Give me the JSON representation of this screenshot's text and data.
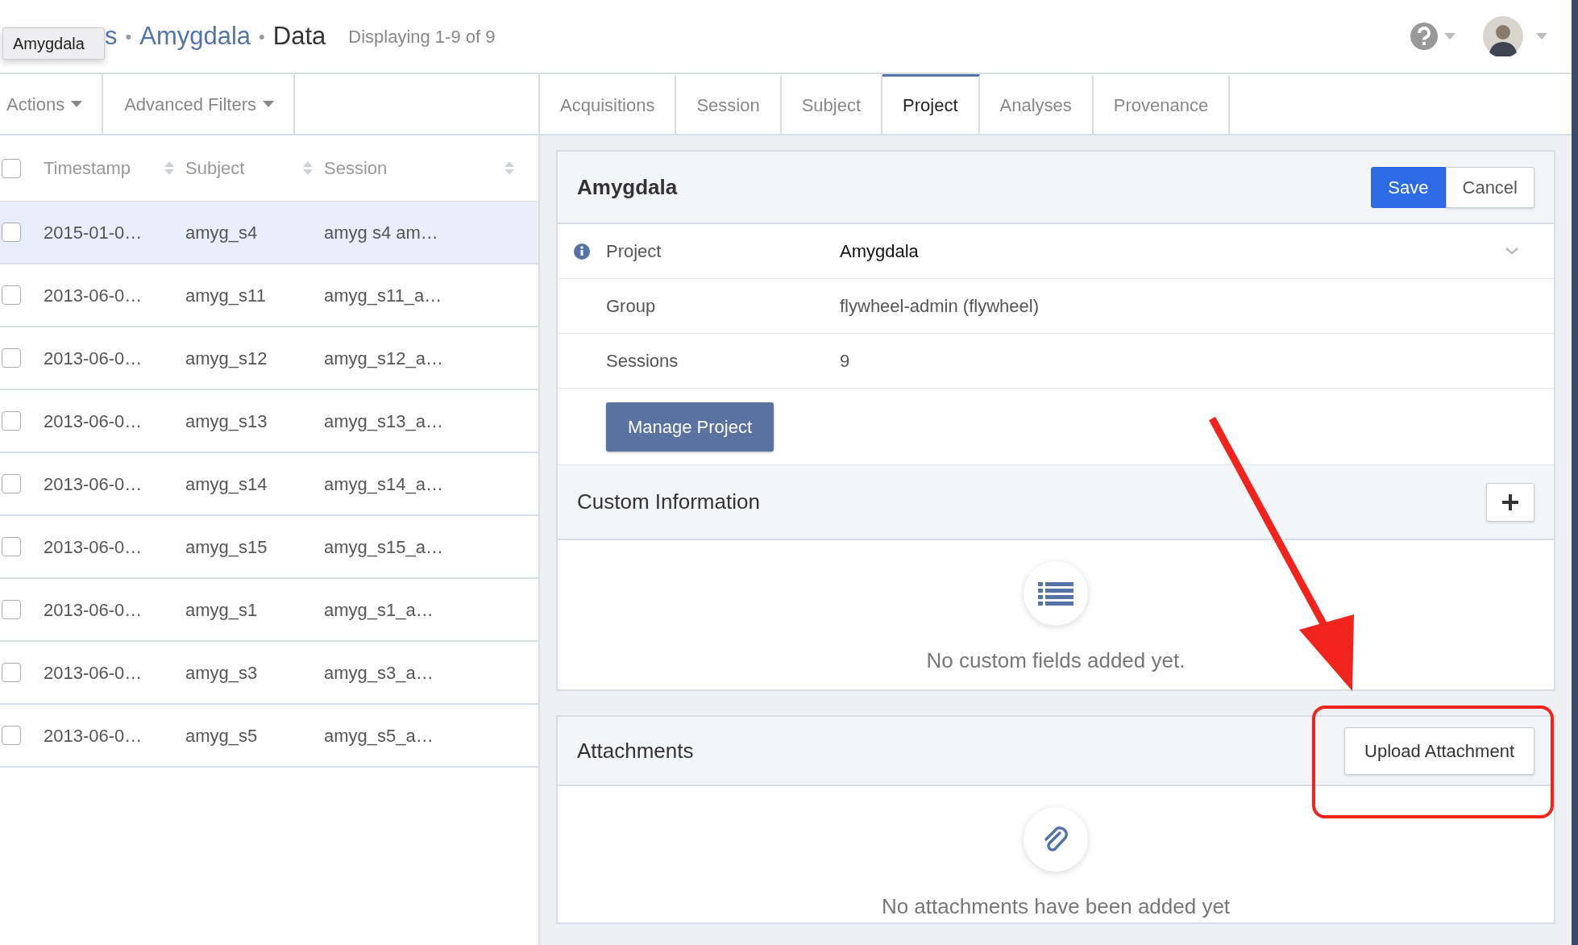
{
  "breadcrumb": {
    "separator": "•",
    "items": [
      {
        "label": "s",
        "kind": "link"
      },
      {
        "label": "Amygdala",
        "kind": "link"
      },
      {
        "label": "Data",
        "kind": "current"
      }
    ]
  },
  "tooltip": "Amygdala",
  "count": "Displaying 1-9 of 9",
  "toolbar": [
    {
      "label": "Actions"
    },
    {
      "label": "Advanced Filters"
    }
  ],
  "table": {
    "all_checked": false,
    "columns": [
      "Timestamp",
      "Subject",
      "Session"
    ],
    "rows": [
      {
        "cells": [
          "2015-01-0…",
          "amyg_s4",
          "amyg s4 am…"
        ],
        "selected": true,
        "checked": false
      },
      {
        "cells": [
          "2013-06-0…",
          "amyg_s11",
          "amyg_s11_a…"
        ],
        "selected": false,
        "checked": false
      },
      {
        "cells": [
          "2013-06-0…",
          "amyg_s12",
          "amyg_s12_a…"
        ],
        "selected": false,
        "checked": false
      },
      {
        "cells": [
          "2013-06-0…",
          "amyg_s13",
          "amyg_s13_a…"
        ],
        "selected": false,
        "checked": false
      },
      {
        "cells": [
          "2013-06-0…",
          "amyg_s14",
          "amyg_s14_a…"
        ],
        "selected": false,
        "checked": false
      },
      {
        "cells": [
          "2013-06-0…",
          "amyg_s15",
          "amyg_s15_a…"
        ],
        "selected": false,
        "checked": false
      },
      {
        "cells": [
          "2013-06-0…",
          "amyg_s1",
          "amyg_s1_a…"
        ],
        "selected": false,
        "checked": false
      },
      {
        "cells": [
          "2013-06-0…",
          "amyg_s3",
          "amyg_s3_a…"
        ],
        "selected": false,
        "checked": false
      },
      {
        "cells": [
          "2013-06-0…",
          "amyg_s5",
          "amyg_s5_a…"
        ],
        "selected": false,
        "checked": false
      }
    ]
  },
  "tabs": [
    {
      "label": "Acquisitions",
      "selected": false
    },
    {
      "label": "Session",
      "selected": false
    },
    {
      "label": "Subject",
      "selected": false
    },
    {
      "label": "Project",
      "selected": true
    },
    {
      "label": "Analyses",
      "selected": false
    },
    {
      "label": "Provenance",
      "selected": false
    }
  ],
  "project_card": {
    "title": "Amygdala",
    "buttons": [
      {
        "label": "Save",
        "kind": "primary"
      },
      {
        "label": "Cancel",
        "kind": "default"
      }
    ],
    "fields": [
      {
        "label": "Project",
        "value": "Amygdala",
        "kind": "select",
        "info": true
      },
      {
        "label": "Group",
        "value": "flywheel-admin (flywheel)",
        "kind": "text",
        "info": false
      },
      {
        "label": "Sessions",
        "value": "9",
        "kind": "text",
        "info": false
      }
    ],
    "manage_button": "Manage Project"
  },
  "custom_info": {
    "title": "Custom Information",
    "empty_text": "No custom fields added yet."
  },
  "attachments": {
    "title": "Attachments",
    "upload_button": "Upload Attachment",
    "empty_text": "No attachments have been added yet"
  }
}
